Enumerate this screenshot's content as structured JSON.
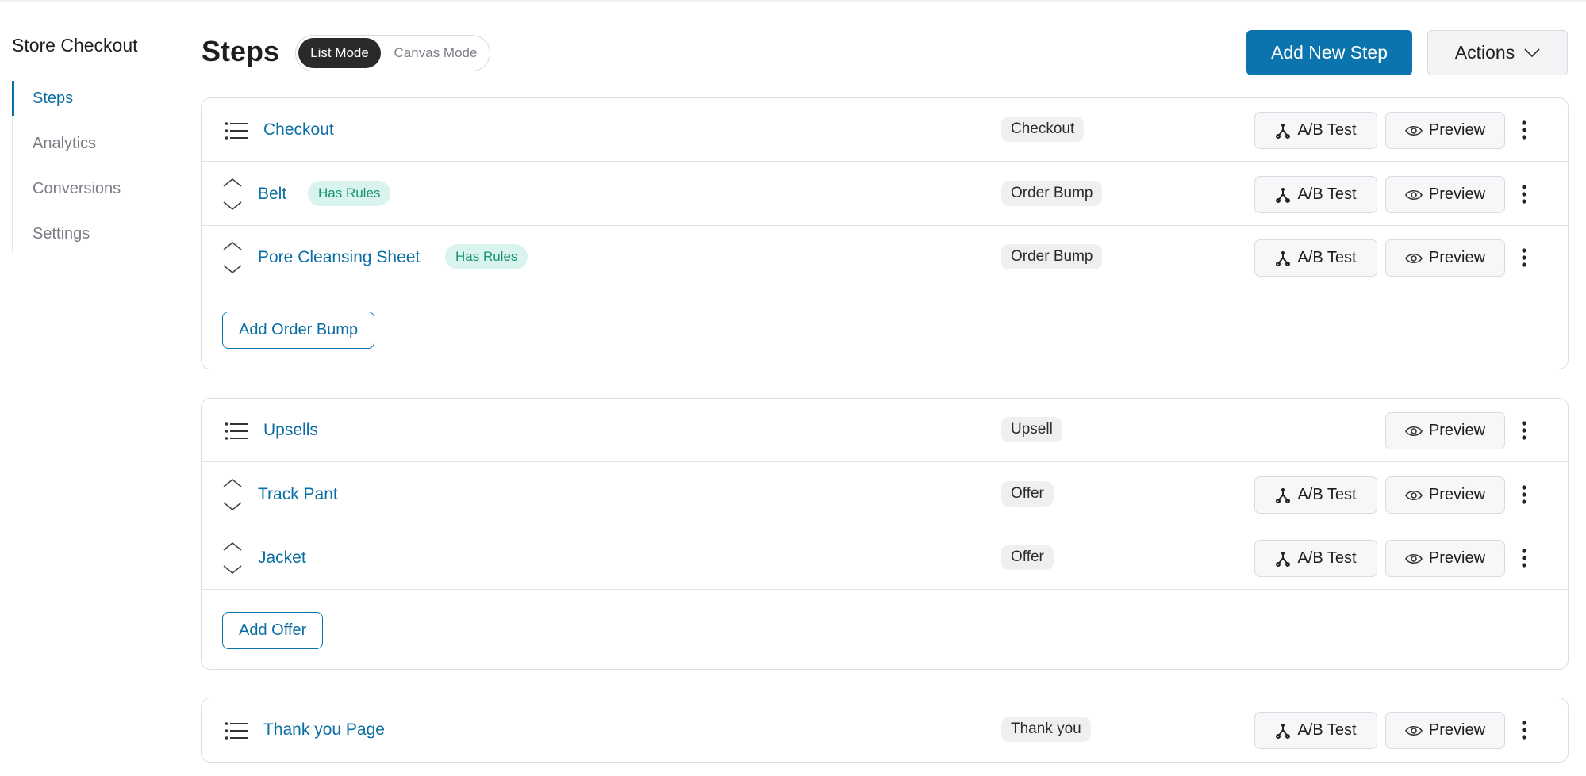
{
  "sidebar": {
    "title": "Store Checkout",
    "items": [
      {
        "label": "Steps",
        "active": true
      },
      {
        "label": "Analytics",
        "active": false
      },
      {
        "label": "Conversions",
        "active": false
      },
      {
        "label": "Settings",
        "active": false
      }
    ]
  },
  "header": {
    "title": "Steps",
    "mode_toggle": {
      "list": "List Mode",
      "canvas": "Canvas Mode",
      "selected": "List Mode"
    },
    "add_step_label": "Add New Step",
    "actions_label": "Actions"
  },
  "buttons": {
    "ab_test": "A/B Test",
    "preview": "Preview"
  },
  "groups": [
    {
      "name": "Checkout",
      "type": "Checkout",
      "has_ab_test": true,
      "children": [
        {
          "name": "Belt",
          "tag": "Has Rules",
          "type": "Order Bump"
        },
        {
          "name": "Pore Cleansing Sheet",
          "tag": "Has Rules",
          "type": "Order Bump"
        }
      ],
      "add_label": "Add Order Bump"
    },
    {
      "name": "Upsells",
      "type": "Upsell",
      "has_ab_test": false,
      "children": [
        {
          "name": "Track Pant",
          "type": "Offer"
        },
        {
          "name": "Jacket",
          "type": "Offer"
        }
      ],
      "add_label": "Add Offer"
    },
    {
      "name": "Thank you Page",
      "type": "Thank you",
      "has_ab_test": true,
      "children": []
    }
  ],
  "colors": {
    "accent": "#0b73ad",
    "link": "#0b6ea3",
    "rules_tag_bg": "#d9f4ee",
    "rules_tag_text": "#17936f",
    "badge_bg": "#eeeff1"
  },
  "icons": {
    "list": "list-icon",
    "reorder": "reorder-arrows-icon",
    "ab_test": "ab-test-branch-icon",
    "preview": "eye-icon",
    "more": "more-vertical-icon",
    "dropdown": "chevron-down-icon"
  }
}
